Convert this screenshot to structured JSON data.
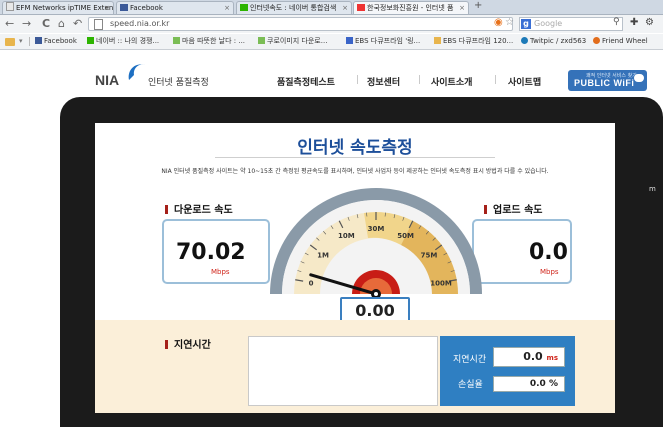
{
  "browser": {
    "tabs": [
      {
        "label": "EFM Networks ipTIME Extender",
        "active": false
      },
      {
        "label": "Facebook",
        "active": false
      },
      {
        "label": "인터넷속도 : 네이버 통합검색",
        "active": false
      },
      {
        "label": "한국정보화진흥원 - 인터넷 품",
        "active": true
      }
    ],
    "new_tab": "+",
    "address": "speed.nia.or.kr",
    "search_placeholder": "Google",
    "bookmarks": [
      "Facebook",
      "네이버 :: 나의 경쟁...",
      "마음 따뜻한 날다 : ...",
      "쿠로이미지 다운로...",
      "EBS 다큐프라임 '링...",
      "EBS 다큐프라임 120...",
      "Twitpic / zxd563",
      "Friend Wheel"
    ]
  },
  "header": {
    "logo": "NIA",
    "logo_sub": "인터넷 품질측정",
    "nav": [
      "품질측정테스트",
      "정보센터",
      "사이트소개",
      "사이트맵"
    ],
    "badge": "PUBLIC WiFi",
    "badge_small": "쾌적 인터넷 서비스 찾기"
  },
  "main": {
    "title": "인터넷 속도측정",
    "description": "NIA 인터넷 품질측정 사이트는 약 10~15초 간 측정된 평균속도를 표시하며, 인터넷 사업자 등이 제공하는 인터넷 속도측정 표시 방법과 다를 수 있습니다."
  },
  "download": {
    "label": "다운로드 속도",
    "value": "70.02",
    "unit": "Mbps"
  },
  "upload": {
    "label": "업로드 속도",
    "value": "0.0",
    "unit": "Mbps"
  },
  "gauge": {
    "readout": "0.00",
    "tick_labels": [
      "0",
      "1M",
      "10M",
      "30M",
      "50M",
      "75M",
      "100M"
    ],
    "needle_value": 0
  },
  "latency": {
    "label": "지연시간",
    "delay_label": "지연시간",
    "delay_value": "0.0",
    "delay_unit": "ms",
    "loss_label": "손실율",
    "loss_value": "0.0",
    "loss_unit": "%"
  },
  "colors": {
    "accent": "#1d4f9a",
    "frame": "#1b1b1b",
    "latency_bg": "#fbefd9",
    "panel": "#2f7fc2",
    "marker": "#a52019"
  }
}
